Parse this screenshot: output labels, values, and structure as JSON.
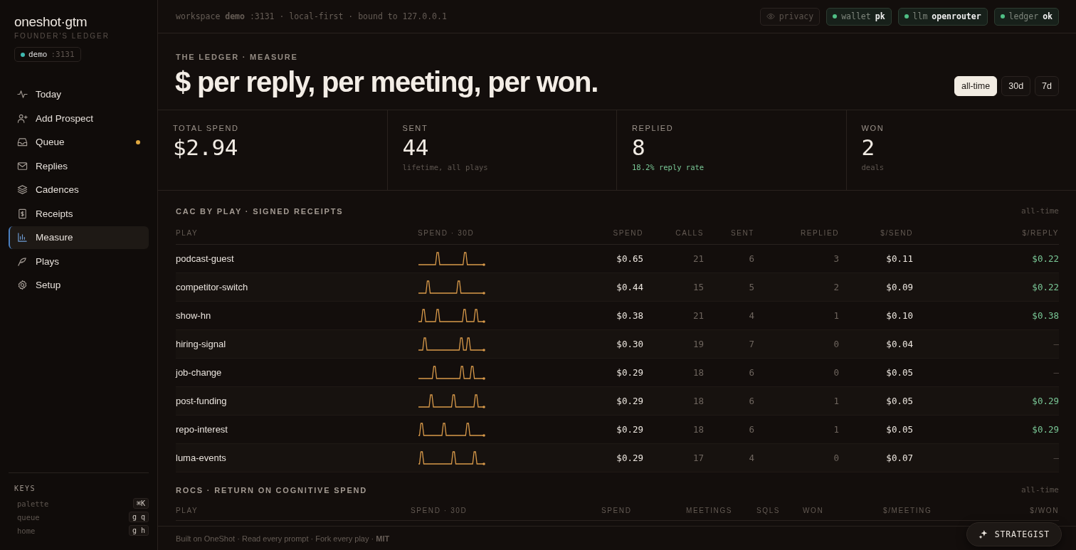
{
  "sidebar": {
    "brand": "oneshot·gtm",
    "subtitle": "FOUNDER'S LEDGER",
    "workspace": {
      "name": "demo",
      "port": ":3131",
      "color": "#3fb8b0"
    },
    "items": [
      {
        "label": "Today",
        "selected": false,
        "unread": false
      },
      {
        "label": "Add Prospect",
        "selected": false,
        "unread": false
      },
      {
        "label": "Queue",
        "selected": false,
        "unread": true
      },
      {
        "label": "Replies",
        "selected": false,
        "unread": false
      },
      {
        "label": "Cadences",
        "selected": false,
        "unread": false
      },
      {
        "label": "Receipts",
        "selected": false,
        "unread": false
      },
      {
        "label": "Measure",
        "selected": true,
        "unread": false
      },
      {
        "label": "Plays",
        "selected": false,
        "unread": false
      },
      {
        "label": "Setup",
        "selected": false,
        "unread": false
      }
    ],
    "keys_title": "KEYS",
    "keys": [
      {
        "label": "palette",
        "key": "⌘K"
      },
      {
        "label": "queue",
        "key": "g q"
      },
      {
        "label": "home",
        "key": "g h"
      }
    ]
  },
  "topbar": {
    "info": "workspace **demo** :3131 · local-first · bound to 127.0.0.1",
    "pills": [
      {
        "kind": "toggle",
        "label": "privacy"
      },
      {
        "kind": "status",
        "label": "wallet",
        "value": "pk",
        "color": "#4fbf85"
      },
      {
        "kind": "status",
        "label": "llm",
        "value": "openrouter",
        "color": "#4fbf85"
      },
      {
        "kind": "status",
        "label": "ledger",
        "value": "ok",
        "color": "#4fbf85"
      }
    ]
  },
  "hero": {
    "eyebrow": "THE LEDGER · MEASURE",
    "title": "$ per reply, per meeting, per won.",
    "ranges": [
      {
        "label": "all-time",
        "selected": true
      },
      {
        "label": "30d",
        "selected": false
      },
      {
        "label": "7d",
        "selected": false
      }
    ]
  },
  "stats": [
    {
      "label": "TOTAL SPEND",
      "value": "$2.94"
    },
    {
      "label": "SENT",
      "value": "44",
      "note": "lifetime, all plays",
      "positive": false
    },
    {
      "label": "REPLIED",
      "value": "8",
      "note": "18.2% reply rate",
      "positive": true
    },
    {
      "label": "WON",
      "value": "2",
      "note": "deals",
      "positive": false
    }
  ],
  "cac_table": {
    "title": "CAC BY PLAY · SIGNED RECEIPTS",
    "range": "all-time",
    "columns": [
      "PLAY",
      "SPEND · 30D",
      "SPEND",
      "CALLS",
      "SENT",
      "REPLIED",
      "$/SEND",
      "$/REPLY"
    ],
    "rows": [
      {
        "play": "podcast-guest",
        "spend": "$0.65",
        "calls": "21",
        "sent": "6",
        "replied": "3",
        "per_send": "$0.11",
        "per_reply": "$0.22",
        "positive": true
      },
      {
        "play": "competitor-switch",
        "spend": "$0.44",
        "calls": "15",
        "sent": "5",
        "replied": "2",
        "per_send": "$0.09",
        "per_reply": "$0.22",
        "positive": true
      },
      {
        "play": "show-hn",
        "spend": "$0.38",
        "calls": "21",
        "sent": "4",
        "replied": "1",
        "per_send": "$0.10",
        "per_reply": "$0.38",
        "positive": true
      },
      {
        "play": "hiring-signal",
        "spend": "$0.30",
        "calls": "19",
        "sent": "7",
        "replied": "0",
        "per_send": "$0.04",
        "per_reply": "—",
        "positive": false
      },
      {
        "play": "job-change",
        "spend": "$0.29",
        "calls": "18",
        "sent": "6",
        "replied": "0",
        "per_send": "$0.05",
        "per_reply": "—",
        "positive": false
      },
      {
        "play": "post-funding",
        "spend": "$0.29",
        "calls": "18",
        "sent": "6",
        "replied": "1",
        "per_send": "$0.05",
        "per_reply": "$0.29",
        "positive": true
      },
      {
        "play": "repo-interest",
        "spend": "$0.29",
        "calls": "18",
        "sent": "6",
        "replied": "1",
        "per_send": "$0.05",
        "per_reply": "$0.29",
        "positive": true
      },
      {
        "play": "luma-events",
        "spend": "$0.29",
        "calls": "17",
        "sent": "4",
        "replied": "0",
        "per_send": "$0.07",
        "per_reply": "—",
        "positive": false
      }
    ]
  },
  "rocs_table": {
    "title": "ROCS · RETURN ON COGNITIVE SPEND",
    "range": "all-time",
    "columns": [
      "PLAY",
      "SPEND · 30D",
      "SPEND",
      "MEETINGS",
      "SQLS",
      "WON",
      "$/MEETING",
      "$/WON"
    ]
  },
  "strategist_button": "STRATEGIST",
  "footer": "Built on OneShot · Read every prompt · Fork every play · **MIT**"
}
